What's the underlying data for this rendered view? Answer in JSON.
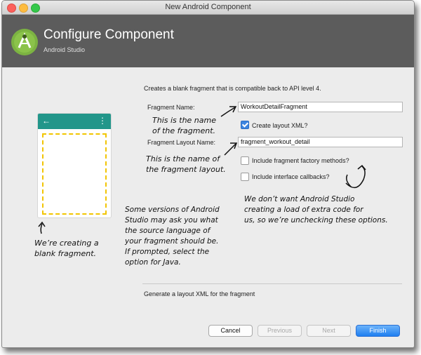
{
  "window": {
    "title": "New Android Component"
  },
  "header": {
    "title": "Configure Component",
    "subtitle": "Android Studio"
  },
  "main": {
    "description": "Creates a blank fragment that is compatible back to API level 4.",
    "fragment_name_label": "Fragment Name:",
    "fragment_name_value": "WorkoutDetailFragment",
    "create_layout_label": "Create layout XML?",
    "create_layout_checked": true,
    "layout_name_label": "Fragment Layout Name:",
    "layout_name_value": "fragment_workout_detail",
    "factory_label": "Include fragment factory methods?",
    "factory_checked": false,
    "callbacks_label": "Include interface callbacks?",
    "callbacks_checked": false,
    "footer_description": "Generate a layout XML for the fragment"
  },
  "preview": {
    "back_icon": "←",
    "menu_icon": "⋮"
  },
  "annotations": {
    "fragment_name_note": "This is the name\nof the fragment.",
    "layout_name_note": "This is the name of\nthe fragment layout.",
    "unchecking_note": "We don’t want Android Studio\ncreating a load of extra code for\nus, so we’re unchecking these options.",
    "language_note": "Some versions of Android\nStudio may ask you what\nthe source language of\nyour fragment should be.\nIf prompted, select the\noption for Java.",
    "blank_note": "We’re creating a\nblank fragment."
  },
  "buttons": {
    "cancel": "Cancel",
    "previous": "Previous",
    "next": "Next",
    "finish": "Finish"
  },
  "colors": {
    "header_bg": "#5c5c5c",
    "preview_bar": "#22968a",
    "dashed_frame": "#f2c500",
    "accent": "#1e7ef0"
  }
}
